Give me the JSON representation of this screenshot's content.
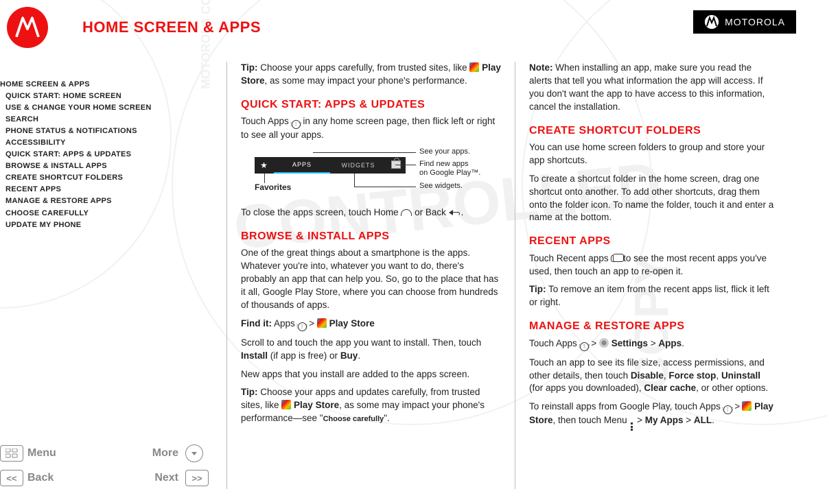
{
  "header": {
    "page_title": "HOME SCREEN & APPS",
    "brand": "MOTOROLA"
  },
  "toc": {
    "top": "Home screen & apps",
    "items": [
      "Quick start: Home screen",
      "Use & change your home screen",
      "Search",
      "Phone status & notifications",
      "Accessibility",
      "Quick start: Apps & updates",
      "Browse & install apps",
      "Create shortcut folders",
      "Recent apps",
      "Manage & restore apps",
      "Choose carefully",
      "Update my phone"
    ]
  },
  "nav": {
    "menu": "Menu",
    "more": "More",
    "back": "Back",
    "next": "Next"
  },
  "col1": {
    "tip_label": "Tip:",
    "tip_text_a": " Choose your apps carefully, from trusted sites, like ",
    "play_store": "Play Store",
    "tip_text_b": ", as some may impact your phone's performance.",
    "h_quick": "Quick start: Apps & updates",
    "quick_p": "Touch Apps  in any home screen page, then flick left or right to see all your apps.",
    "diagram": {
      "tab_apps": "APPS",
      "tab_widgets": "WIDGETS",
      "c1": "See your apps.",
      "c2a": "Find new apps",
      "c2b": "on Google Play™.",
      "c3": "See widgets.",
      "fav": "Favorites"
    },
    "close_a": "To close the apps screen, touch Home ",
    "close_b": " or Back ",
    "close_c": ".",
    "h_browse": "Browse & install apps",
    "browse_p1": "One of the great things about a smartphone is the apps. Whatever you're into, whatever you want to do, there's probably an app that can help you. So, go to the place that has it all, Google Play Store, where you can choose from hundreds of thousands of apps.",
    "find_label": "Find it:",
    "find_a": " Apps ",
    "gt": " > ",
    "browse_p2a": "Scroll to and touch the app you want to install. Then, touch ",
    "install": "Install",
    "browse_p2b": " (if app is free) or ",
    "buy": "Buy",
    "browse_p2c": ".",
    "browse_p3": "New apps that you install are added to the apps screen.",
    "tip2_a": " Choose your apps and updates carefully, from trusted sites, like ",
    "tip2_b": ", as some may impact your phone's performance—see \"",
    "choose_carefully": "Choose carefully",
    "tip2_c": "\"."
  },
  "col2": {
    "note_label": "Note:",
    "note_text": " When installing an app, make sure you read the alerts that tell you what information the app will access. If you don't want the app to have access to this information, cancel the installation.",
    "h_folders": "Create shortcut folders",
    "folders_p1": "You can use home screen folders to group and store your app shortcuts.",
    "folders_p2": "To create a shortcut folder in the home screen, drag one shortcut onto another. To add other shortcuts, drag them onto the folder icon. To name the folder, touch it and enter a name at the bottom.",
    "h_recent": "Recent apps",
    "recent_p1a": "Touch Recent apps ",
    "recent_p1b": " to see the most recent apps you've used, then touch an app to re-open it.",
    "recent_tip": " To remove an item from the recent apps list, flick it left or right.",
    "h_manage": "Manage & restore apps",
    "manage_p1a": "Touch Apps ",
    "settings": "Settings",
    "apps_label": "Apps",
    "manage_p2a": "Touch an app to see its file size, access permissions, and other details, then touch ",
    "disable": "Disable",
    "force": "Force stop",
    "uninstall": "Uninstall",
    "manage_p2b": " (for apps you downloaded), ",
    "clear": "Clear cache",
    "manage_p2c": ", or other options.",
    "manage_p3a": "To reinstall apps from Google Play, touch Apps ",
    "manage_p3b": ", then touch Menu ",
    "myapps": "My Apps",
    "all": "ALL"
  }
}
